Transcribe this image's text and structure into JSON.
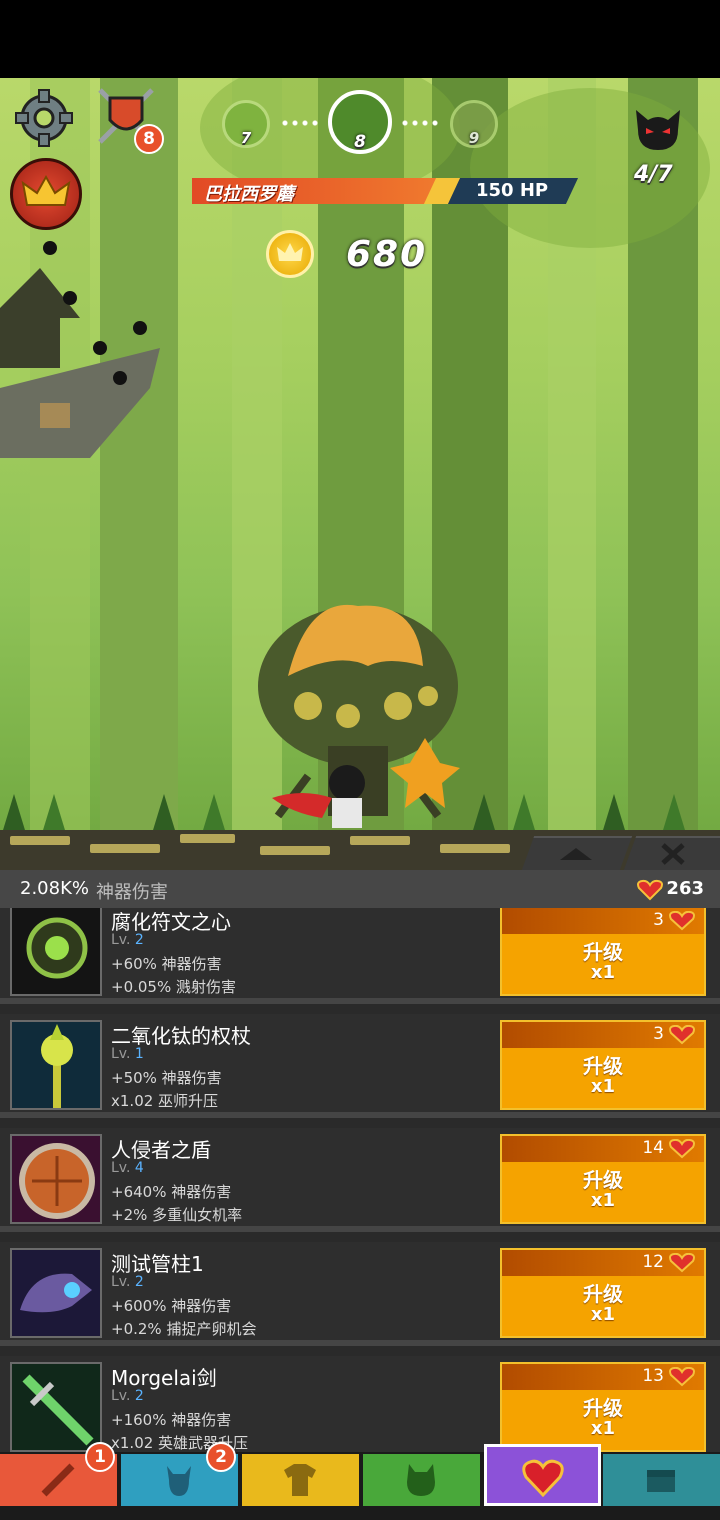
{
  "hud": {
    "shield_badge": "8",
    "stages": {
      "prev": "7",
      "current": "8",
      "next": "9"
    },
    "boss": {
      "name": "巴拉西罗蘑",
      "hp": "150 HP"
    },
    "wave_progress": "4/7",
    "gold": "680"
  },
  "panel": {
    "damage_value": "2.08K%",
    "damage_label": "神器伤害",
    "relic_count": "263"
  },
  "artifacts": [
    {
      "name": "腐化符文之心",
      "lv_label": "Lv.",
      "level": "2",
      "effect1": "+60% 神器伤害",
      "effect2": "+0.05% 溅射伤害",
      "cost": "3",
      "upgrade_label": "升级",
      "multiplier": "x1"
    },
    {
      "name": "二氧化钛的权杖",
      "lv_label": "Lv.",
      "level": "1",
      "effect1": "+50% 神器伤害",
      "effect2": "x1.02 巫师升压",
      "cost": "3",
      "upgrade_label": "升级",
      "multiplier": "x1"
    },
    {
      "name": "人侵者之盾",
      "lv_label": "Lv.",
      "level": "4",
      "effect1": "+640% 神器伤害",
      "effect2": "+2% 多重仙女机率",
      "cost": "14",
      "upgrade_label": "升级",
      "multiplier": "x1"
    },
    {
      "name": "测试管柱1",
      "lv_label": "Lv.",
      "level": "2",
      "effect1": "+600% 神器伤害",
      "effect2": "+0.2% 捕捉产卵机会",
      "cost": "12",
      "upgrade_label": "升级",
      "multiplier": "x1"
    },
    {
      "name": "Morgelai剑",
      "lv_label": "Lv.",
      "level": "2",
      "effect1": "+160% 神器伤害",
      "effect2": "x1.02 英雄武器升压",
      "cost": "13",
      "upgrade_label": "升级",
      "multiplier": "x1"
    }
  ],
  "nav": {
    "tabs": [
      {
        "icon": "sword-icon",
        "color": "#e8583a",
        "badge": "1"
      },
      {
        "icon": "hero-icon",
        "color": "#2f9fc0",
        "badge": "2"
      },
      {
        "icon": "shirt-icon",
        "color": "#e9b91c",
        "badge": ""
      },
      {
        "icon": "pet-icon",
        "color": "#49a83a",
        "badge": ""
      },
      {
        "icon": "artifact-heart-icon",
        "color": "#8c52d8",
        "badge": ""
      },
      {
        "icon": "shop-chest-icon",
        "color": "#2f8f98",
        "badge": ""
      }
    ]
  },
  "colors": {
    "upgrade_button": "#f5a300",
    "level_blue": "#5ab3ff",
    "boss_bar": "#e24a25"
  }
}
